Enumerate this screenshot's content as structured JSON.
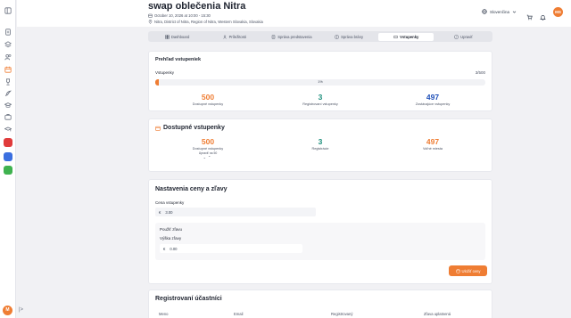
{
  "event": {
    "title": "swap oblečenia Nitra",
    "datetime": "October 10, 2026 at 10:00 - 15:30",
    "location": "Nitra, District of Nitra, Region of Nitra, Western Slovakia, Slovakia"
  },
  "topbar": {
    "language": "Slovenčina",
    "avatar_initials": "MS"
  },
  "sidebar": {
    "avatar_initials": "M",
    "expand_label": "|>"
  },
  "tabs": [
    {
      "label": "Dashboard",
      "icon": "dashboard-icon"
    },
    {
      "label": "Príležitosti",
      "icon": "users-icon"
    },
    {
      "label": "Správa predstavenia",
      "icon": "document-icon"
    },
    {
      "label": "Správa brány",
      "icon": "gate-icon"
    },
    {
      "label": "Vstupenky",
      "icon": "ticket-icon",
      "active": true
    },
    {
      "label": "Upraviť",
      "icon": "edit-icon"
    }
  ],
  "overview": {
    "title": "Prehľad vstupeniek",
    "bar_label": "Vstupenky",
    "bar_count": "3/500",
    "bar_percent": "1%",
    "bar_fraction": 0.01,
    "stats": [
      {
        "value": "500",
        "label": "Dostupné vstupenky",
        "color": "#ef7d33"
      },
      {
        "value": "3",
        "label": "Registrovaní vstupenky",
        "color": "#1d8f7c"
      },
      {
        "value": "497",
        "label": "Zostávajúce vstupenky",
        "color": "#1e4fb8"
      }
    ]
  },
  "available": {
    "title": "Dostupné vstupenky",
    "stats": [
      {
        "value": "500",
        "label": "Dostupné vstupenky",
        "sub": "Upraviť na 50",
        "color": "#ef7d33"
      },
      {
        "value": "3",
        "label": "Registrácie",
        "color": "#1d8f7c"
      },
      {
        "value": "497",
        "label": "Voľné miesta",
        "color": "#ef7d33"
      }
    ]
  },
  "pricing": {
    "title": "Nastavenia ceny a zľavy",
    "price_label": "Cena vstupenky",
    "currency": "€",
    "price_value": "3.00",
    "discount_label": "Použiť zľavu",
    "discount_amount_label": "Výška zľavy",
    "discount_value": "0.00",
    "save_label": "Uložiť ceny"
  },
  "participants": {
    "title": "Registrovaní účastníci",
    "columns": [
      "Meno",
      "Email",
      "Registrovaný",
      "Zľava uplatnená"
    ]
  },
  "colors": {
    "accent": "#ef7d33",
    "teal": "#1d8f7c",
    "blue": "#1e4fb8"
  }
}
